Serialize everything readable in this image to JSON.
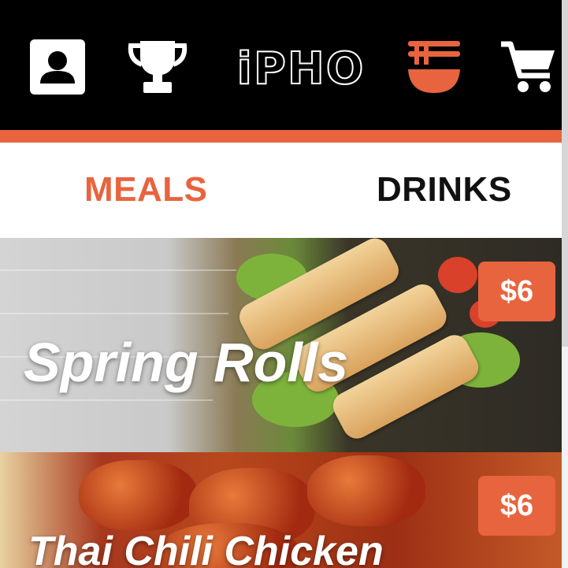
{
  "header": {
    "logo_text": "iPHO",
    "icons": [
      "user-icon",
      "trophy-icon",
      "noodle-bowl-icon",
      "cart-icon"
    ],
    "accent_color": "#e8643e",
    "background_color": "#000000"
  },
  "tabs": [
    {
      "label": "MEALS",
      "active": true
    },
    {
      "label": "DRINKS",
      "active": false
    }
  ],
  "menu_items": [
    {
      "name": "Spring Rolls",
      "price": "$6"
    },
    {
      "name": "Thai Chili Chicken",
      "price": "$6"
    }
  ]
}
